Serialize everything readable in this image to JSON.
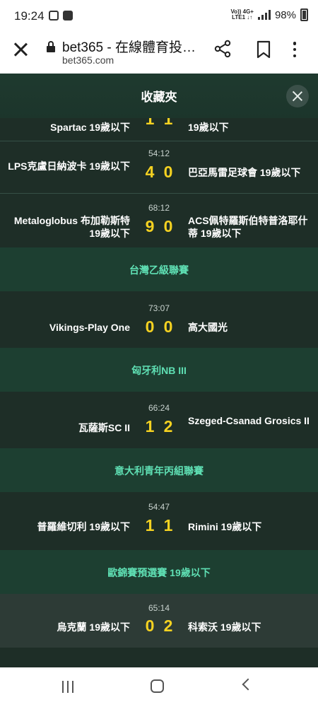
{
  "status_bar": {
    "time": "19:24",
    "network_top": "Vo)) 4G+",
    "network_bottom": "LTE1 ↓↑",
    "battery": "98%"
  },
  "browser": {
    "title": "bet365 - 在線體育投…",
    "url": "bet365.com"
  },
  "favorites": {
    "title": "收藏夾"
  },
  "matches": [
    {
      "clock": "",
      "home": "Spartac 19歲以下",
      "away": "19歲以下",
      "score_home": "1",
      "score_away": "1"
    },
    {
      "clock": "54:12",
      "home": "LPS克盧日納波卡 19歲以下",
      "away": "巴亞馬雷足球會 19歲以下",
      "score_home": "4",
      "score_away": "0"
    },
    {
      "clock": "68:12",
      "home": "Metaloglobus 布加勒斯特 19歲以下",
      "away": "ACS佩特羅斯伯特普洛耶什蒂 19歲以下",
      "score_home": "9",
      "score_away": "0"
    },
    {
      "clock": "73:07",
      "home": "Vikings-Play One",
      "away": "高大國光",
      "score_home": "0",
      "score_away": "0"
    },
    {
      "clock": "66:24",
      "home": "瓦薩斯SC II",
      "away": "Szeged-Csanad Grosics II",
      "score_home": "1",
      "score_away": "2"
    },
    {
      "clock": "54:47",
      "home": "普羅維切利 19歲以下",
      "away": "Rimini 19歲以下",
      "score_home": "1",
      "score_away": "1"
    },
    {
      "clock": "65:14",
      "home": "烏克蘭 19歲以下",
      "away": "科索沃 19歲以下",
      "score_home": "0",
      "score_away": "2"
    }
  ],
  "leagues": [
    {
      "name": "台灣乙級聯賽"
    },
    {
      "name": "匈牙利NB III"
    },
    {
      "name": "意大利青年丙組聯賽"
    },
    {
      "name": "歐錦賽預選賽 19歲以下"
    }
  ],
  "colors": {
    "background": "#1e2e27",
    "score": "#f5d221",
    "league": "#5fe0b4"
  }
}
